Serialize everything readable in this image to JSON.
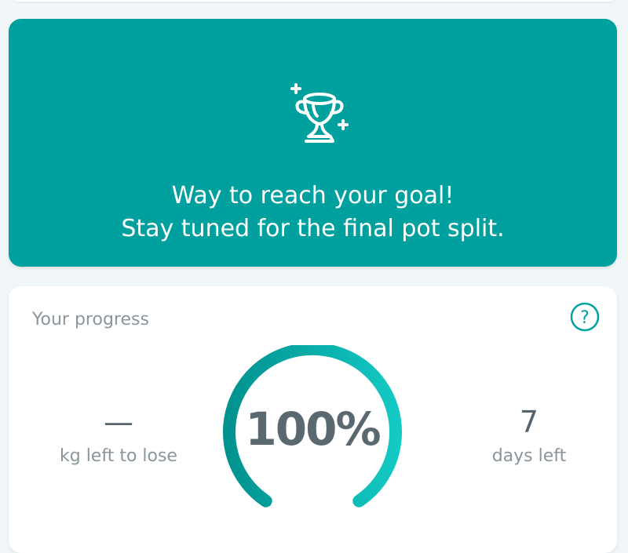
{
  "goal_banner": {
    "line1": "Way to reach your goal!",
    "line2": "Stay tuned for the final pot split.",
    "icon": "trophy-icon",
    "background_color": "#00a09e"
  },
  "progress": {
    "title": "Your progress",
    "help_icon": "help-circle-icon",
    "percent_label": "100%",
    "percent_value": 100,
    "kg_left_value": "—",
    "kg_left_label": "kg left to lose",
    "days_left_value": "7",
    "days_left_label": "days left",
    "gauge_colors": [
      "#00928f",
      "#13c9c3"
    ]
  }
}
